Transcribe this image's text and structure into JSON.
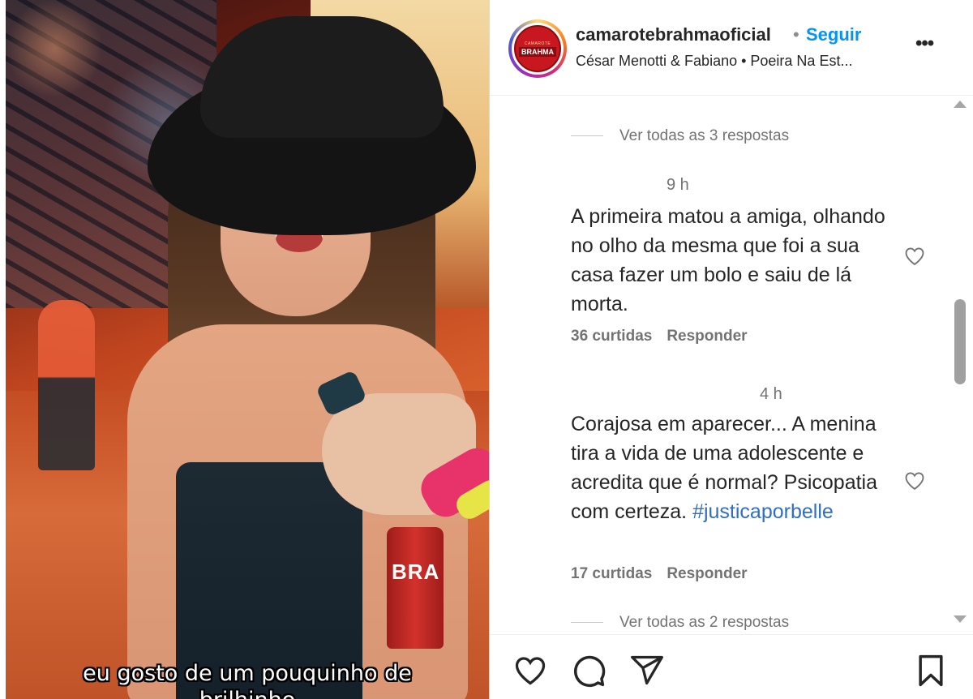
{
  "video": {
    "caption_line1": "eu gosto de um pouquinho de",
    "caption_line2": "brilhinho",
    "can_brand": "BRA"
  },
  "post": {
    "avatar_text_top": "CAMAROTE",
    "avatar_text_bottom": "BRAHMA",
    "username": "camarotebrahmaoficial",
    "separator": "•",
    "follow_label": "Seguir",
    "subtitle": "César Menotti & Fabiano • Poeira Na Est...",
    "more_label": "•••"
  },
  "comments": {
    "view_replies_top": "Ver todas as 3 respostas",
    "items": [
      {
        "time": "9 h",
        "text": "A primeira matou a amiga, olhando no olho da mesma que foi a sua casa fazer um bolo e saiu de lá morta.",
        "likes": "36 curtidas",
        "reply": "Responder"
      },
      {
        "time": "4 h",
        "text": "Corajosa em aparecer... A menina tira a vida de uma adolescente e acredita que é normal? Psicopatia com certeza.",
        "hashtag": "#justicaporbelle",
        "likes": "17 curtidas",
        "reply": "Responder"
      }
    ],
    "view_replies_bottom": "Ver todas as 2 respostas"
  },
  "colors": {
    "link_blue": "#0095f6",
    "hashtag_blue": "#2f6ec4",
    "muted_text": "#737373"
  },
  "icons": [
    "heart-icon",
    "comment-icon",
    "share-icon",
    "bookmark-icon",
    "more-icon"
  ]
}
